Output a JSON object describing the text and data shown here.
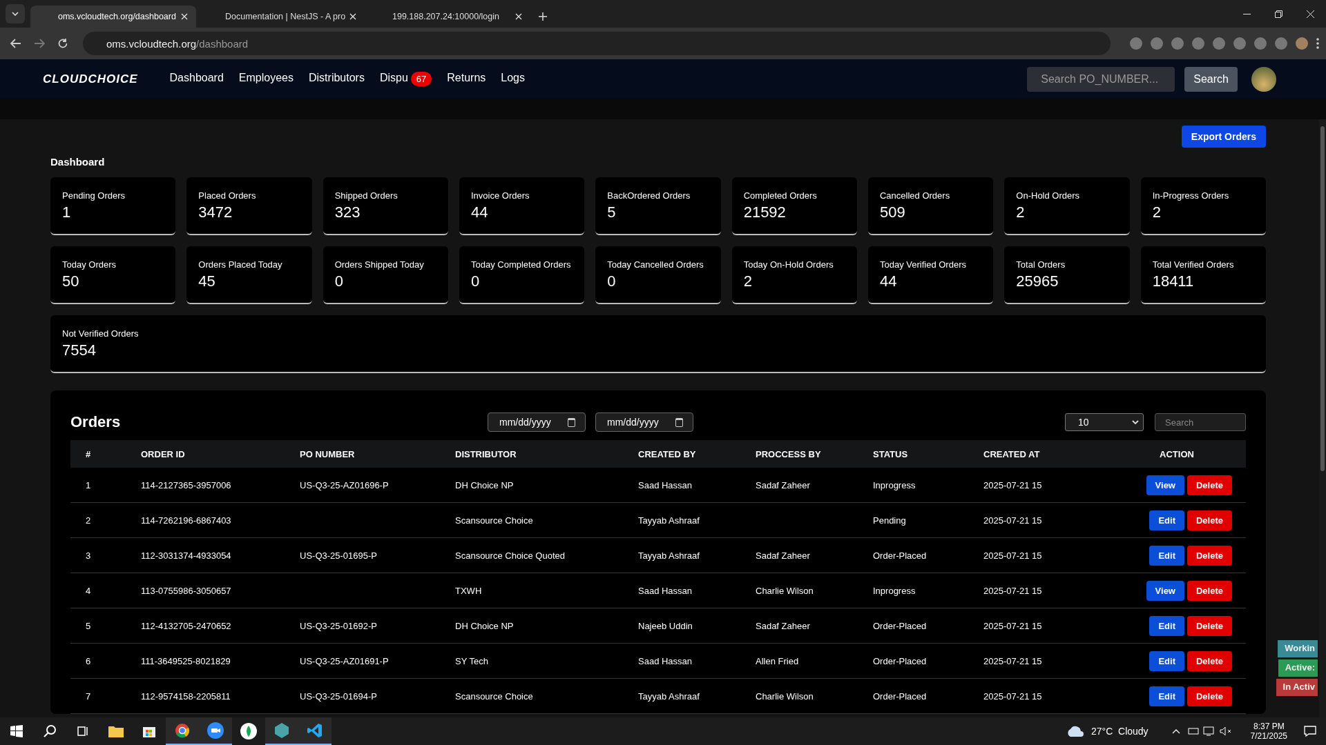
{
  "browser": {
    "tabs": [
      {
        "title": "oms.vcloudtech.org/dashboard",
        "selected": true
      },
      {
        "title": "Documentation | NestJS - A pro",
        "selected": false
      },
      {
        "title": "199.188.207.24:10000/login",
        "selected": false
      }
    ],
    "url_host": "oms.vcloudtech.org",
    "url_path": "/dashboard"
  },
  "navbar": {
    "logo": "CLOUDCHOICE",
    "links": [
      {
        "label": "Dashboard"
      },
      {
        "label": "Employees"
      },
      {
        "label": "Distributors"
      },
      {
        "label": "Dispu",
        "badge": "67"
      },
      {
        "label": "Returns"
      },
      {
        "label": "Logs"
      }
    ],
    "search_placeholder": "Search PO_NUMBER...",
    "search_button": "Search"
  },
  "export_button": "Export Orders",
  "dashboard_title": "Dashboard",
  "stats": [
    {
      "label": "Pending Orders",
      "value": "1"
    },
    {
      "label": "Placed Orders",
      "value": "3472"
    },
    {
      "label": "Shipped Orders",
      "value": "323"
    },
    {
      "label": "Invoice Orders",
      "value": "44"
    },
    {
      "label": "BackOrdered Orders",
      "value": "5"
    },
    {
      "label": "Completed Orders",
      "value": "21592"
    },
    {
      "label": "Cancelled Orders",
      "value": "509"
    },
    {
      "label": "On-Hold Orders",
      "value": "2"
    },
    {
      "label": "In-Progress Orders",
      "value": "2"
    },
    {
      "label": "Today Orders",
      "value": "50"
    },
    {
      "label": "Orders Placed Today",
      "value": "45"
    },
    {
      "label": "Orders Shipped Today",
      "value": "0"
    },
    {
      "label": "Today Completed Orders",
      "value": "0"
    },
    {
      "label": "Today Cancelled Orders",
      "value": "0"
    },
    {
      "label": "Today On-Hold Orders",
      "value": "2"
    },
    {
      "label": "Today Verified Orders",
      "value": "44"
    },
    {
      "label": "Total Orders",
      "value": "25965"
    },
    {
      "label": "Total Verified Orders",
      "value": "18411"
    }
  ],
  "wide_stat": {
    "label": "Not Verified Orders",
    "value": "7554"
  },
  "orders": {
    "title": "Orders",
    "date_placeholders": [
      "mm/dd/yyyy",
      "mm/dd/yyyy"
    ],
    "page_size": "10",
    "search_placeholder": "Search",
    "columns": [
      "#",
      "ORDER ID",
      "PO NUMBER",
      "DISTRIBUTOR",
      "CREATED BY",
      "PROCCESS BY",
      "STATUS",
      "CREATED AT",
      "ACTION"
    ],
    "rows": [
      {
        "cells": [
          "1",
          "114-2127365-3957006",
          "US-Q3-25-AZ01696-P",
          "DH Choice NP",
          "Saad Hassan",
          "Sadaf Zaheer",
          "Inprogress",
          "2025-07-21 15"
        ],
        "primary": "View",
        "secondary": "Delete"
      },
      {
        "cells": [
          "2",
          "114-7262196-6867403",
          "",
          "Scansource Choice",
          "Tayyab Ashraaf",
          "",
          "Pending",
          "2025-07-21 15"
        ],
        "primary": "Edit",
        "secondary": "Delete"
      },
      {
        "cells": [
          "3",
          "112-3031374-4933054",
          "US-Q3-25-01695-P",
          "Scansource Choice Quoted",
          "Tayyab Ashraaf",
          "Sadaf Zaheer",
          "Order-Placed",
          "2025-07-21 15"
        ],
        "primary": "Edit",
        "secondary": "Delete"
      },
      {
        "cells": [
          "4",
          "113-0755986-3050657",
          "",
          "TXWH",
          "Saad Hassan",
          "Charlie Wilson",
          "Inprogress",
          "2025-07-21 15"
        ],
        "primary": "View",
        "secondary": "Delete"
      },
      {
        "cells": [
          "5",
          "112-4132705-2470652",
          "US-Q3-25-01692-P",
          "DH Choice NP",
          "Najeeb Uddin",
          "Sadaf Zaheer",
          "Order-Placed",
          "2025-07-21 15"
        ],
        "primary": "Edit",
        "secondary": "Delete"
      },
      {
        "cells": [
          "6",
          "111-3649525-8021829",
          "US-Q3-25-AZ01691-P",
          "SY Tech",
          "Saad Hassan",
          "Allen Fried",
          "Order-Placed",
          "2025-07-21 15"
        ],
        "primary": "Edit",
        "secondary": "Delete"
      },
      {
        "cells": [
          "7",
          "112-9574158-2205811",
          "US-Q3-25-01694-P",
          "Scansource Choice",
          "Tayyab Ashraaf",
          "Charlie Wilson",
          "Order-Placed",
          "2025-07-21 15"
        ],
        "primary": "Edit",
        "secondary": "Delete"
      }
    ]
  },
  "side_widgets": [
    {
      "label": "Workin",
      "color": "#3a8a96"
    },
    {
      "label": "Active:",
      "color": "#2a9a55"
    },
    {
      "label": "In Activ",
      "color": "#b83a3a"
    }
  ],
  "taskbar": {
    "weather": "27°C  Cloudy",
    "time": "8:37 PM",
    "date": "7/21/2025"
  }
}
